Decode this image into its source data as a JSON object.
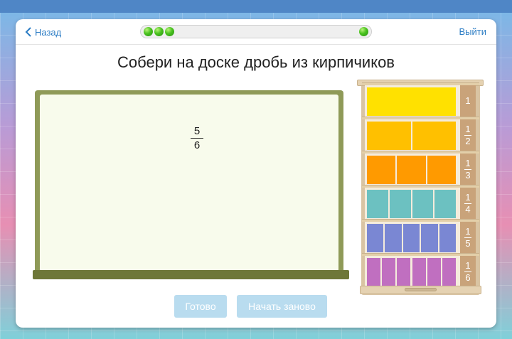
{
  "nav": {
    "back_label": "Назад",
    "exit_label": "Выйти"
  },
  "progress": {
    "completed_dots": 3,
    "total_steps": 4
  },
  "title": "Собери на доске дробь из кирпичиков",
  "target_fraction": {
    "numerator": "5",
    "denominator": "6"
  },
  "buttons": {
    "done_label": "Готово",
    "restart_label": "Начать заново"
  },
  "colors": {
    "accent": "#2b7cc4",
    "button_disabled": "#b9dcef",
    "board_frame": "#8f9a58",
    "board_surface": "#f8fbec"
  },
  "shelf": {
    "rows": [
      {
        "numerator": "1",
        "denominator": "",
        "color": "#ffe100",
        "count": 1
      },
      {
        "numerator": "1",
        "denominator": "2",
        "color": "#ffc000",
        "count": 2
      },
      {
        "numerator": "1",
        "denominator": "3",
        "color": "#ff9a00",
        "count": 3
      },
      {
        "numerator": "1",
        "denominator": "4",
        "color": "#6cc1c1",
        "count": 4
      },
      {
        "numerator": "1",
        "denominator": "5",
        "color": "#7a87d3",
        "count": 5
      },
      {
        "numerator": "1",
        "denominator": "6",
        "color": "#c06fc0",
        "count": 6
      }
    ]
  }
}
